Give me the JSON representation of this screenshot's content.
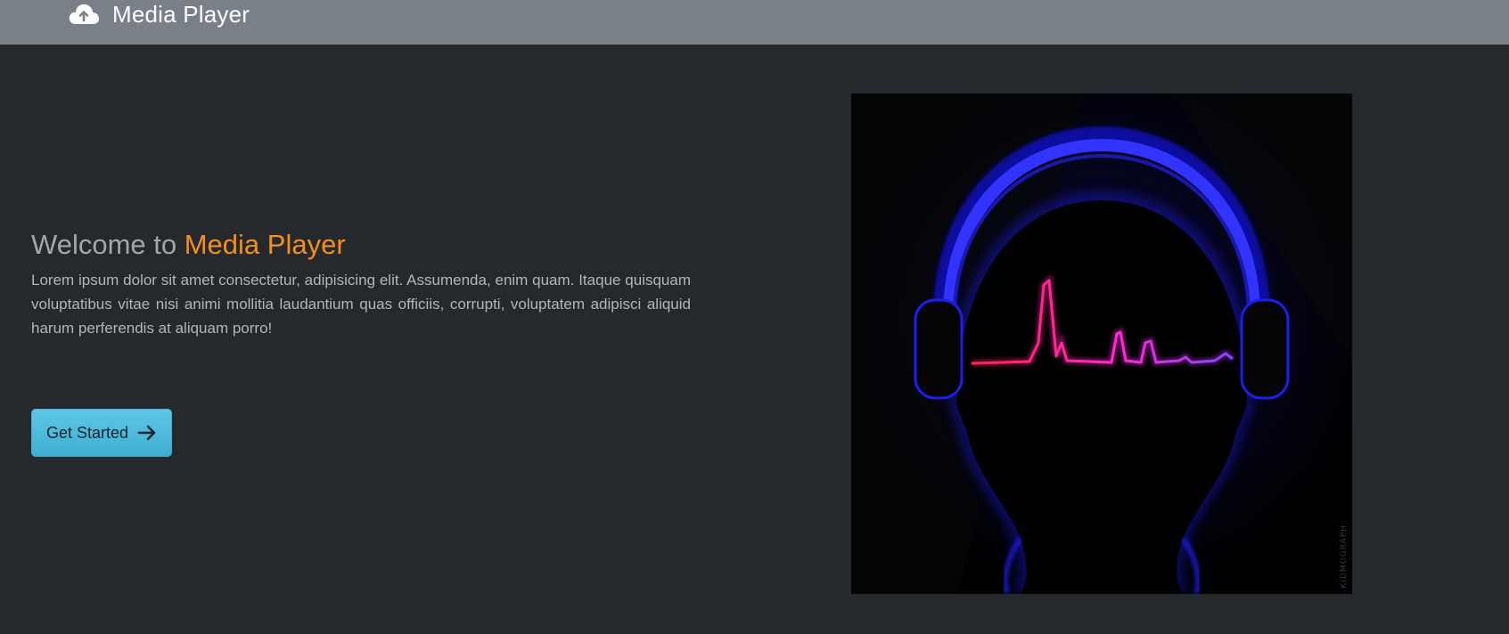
{
  "navbar": {
    "brand_icon": "cloud-upload-icon",
    "brand_text": "Media Player"
  },
  "hero": {
    "title_prefix": "Welcome to",
    "title_accent": "Media Player",
    "description": "Lorem ipsum dolor sit amet consectetur, adipisicing elit. Assumenda, enim quam. Itaque quisquam voluptatibus vitae nisi animi mollitia laudantium quas officiis, corrupti, voluptatem adipisci aliquid harum perferendis at aliquam porro!",
    "cta_label": "Get Started",
    "cta_icon": "arrow-right-icon",
    "image_watermark": "KIDMOGRAPH"
  },
  "colors": {
    "navbar_bg": "#7a8088",
    "page_bg": "#25282d",
    "accent": "#f39019",
    "button": "#5ec7e6"
  }
}
